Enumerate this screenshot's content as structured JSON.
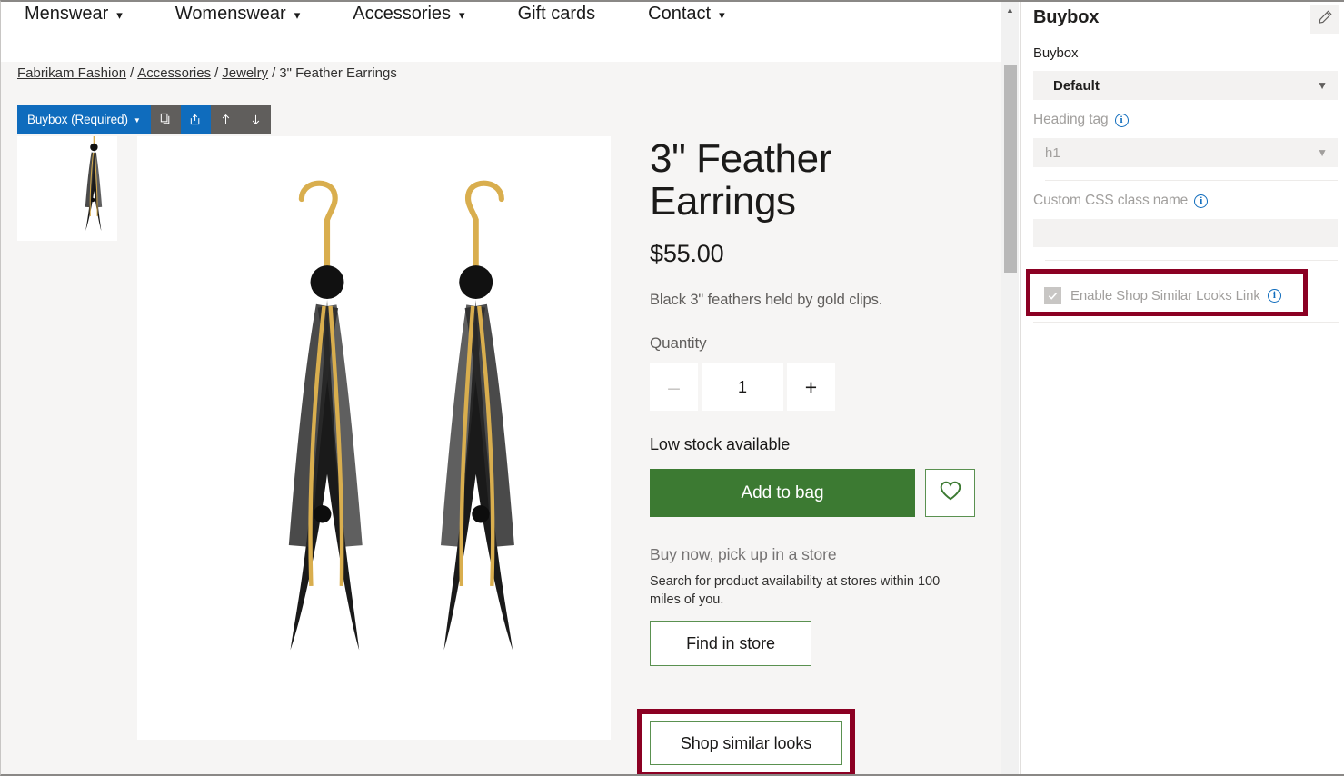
{
  "site_nav": {
    "items": [
      {
        "label": "Menswear",
        "has_chevron": true,
        "icon": "chevron-down-icon"
      },
      {
        "label": "Womenswear",
        "has_chevron": true,
        "icon": "chevron-down-icon"
      },
      {
        "label": "Accessories",
        "has_chevron": true,
        "icon": "chevron-down-icon"
      },
      {
        "label": "Gift cards",
        "has_chevron": false,
        "icon": ""
      },
      {
        "label": "Contact",
        "has_chevron": true,
        "icon": "chevron-down-icon"
      }
    ]
  },
  "breadcrumb": {
    "items": [
      {
        "label": "Fabrikam Fashion",
        "link": true
      },
      {
        "label": "Accessories",
        "link": true
      },
      {
        "label": "Jewelry",
        "link": true
      },
      {
        "label": "3\" Feather Earrings",
        "link": false
      }
    ],
    "separator": "/"
  },
  "module_toolbar": {
    "module_label": "Buybox (Required)",
    "caret": "▾",
    "buttons": [
      {
        "name": "copy-button",
        "icon": "copy-icon",
        "active": false
      },
      {
        "name": "move-button",
        "icon": "share-move-icon",
        "active": true
      },
      {
        "name": "move-up-button",
        "icon": "arrow-up-icon",
        "active": false
      },
      {
        "name": "move-down-button",
        "icon": "arrow-down-icon",
        "active": false
      }
    ]
  },
  "product": {
    "title": "3\" Feather Earrings",
    "price": "$55.00",
    "description": "Black 3\" feathers held by gold clips.",
    "quantity_label": "Quantity",
    "quantity_value": "1",
    "decrement_label": "–",
    "increment_label": "+",
    "stock_status": "Low stock available",
    "add_to_bag_label": "Add to bag",
    "wishlist_icon": "heart-icon",
    "pickup_heading": "Buy now, pick up in a store",
    "pickup_text": "Search for product availability at stores within 100 miles of you.",
    "find_in_store_label": "Find in store",
    "shop_similar_looks_label": "Shop similar looks",
    "image_alt": "3-inch black feather earrings with gold chains",
    "thumbnail_alt": "3-inch black feather earrings thumbnail"
  },
  "pane": {
    "title": "Buybox",
    "subtitle": "Buybox",
    "edit_icon": "pencil-icon",
    "layout_select": {
      "value": "Default",
      "chevron": "⌄"
    },
    "heading_tag": {
      "label": "Heading tag",
      "value": "h1",
      "info_icon": "info-icon",
      "chevron": "⌄",
      "disabled": true
    },
    "custom_css": {
      "label": "Custom CSS class name",
      "value": "",
      "info_icon": "info-icon"
    },
    "enable_shop_similar": {
      "label": "Enable Shop Similar Looks Link",
      "checked": true,
      "disabled": true,
      "info_icon": "info-icon",
      "check_icon": "checkmark-icon"
    }
  },
  "scrollbar": {
    "up_arrow_icon": "caret-up-icon"
  },
  "colors": {
    "accent_blue": "#0f6cbd",
    "toolbar_gray": "#605e5c",
    "cta_green": "#3c7a32",
    "outline_green": "#5a9150",
    "highlight_red": "#8b0023",
    "page_bg": "#f6f5f4",
    "field_bg": "#f3f2f1"
  }
}
